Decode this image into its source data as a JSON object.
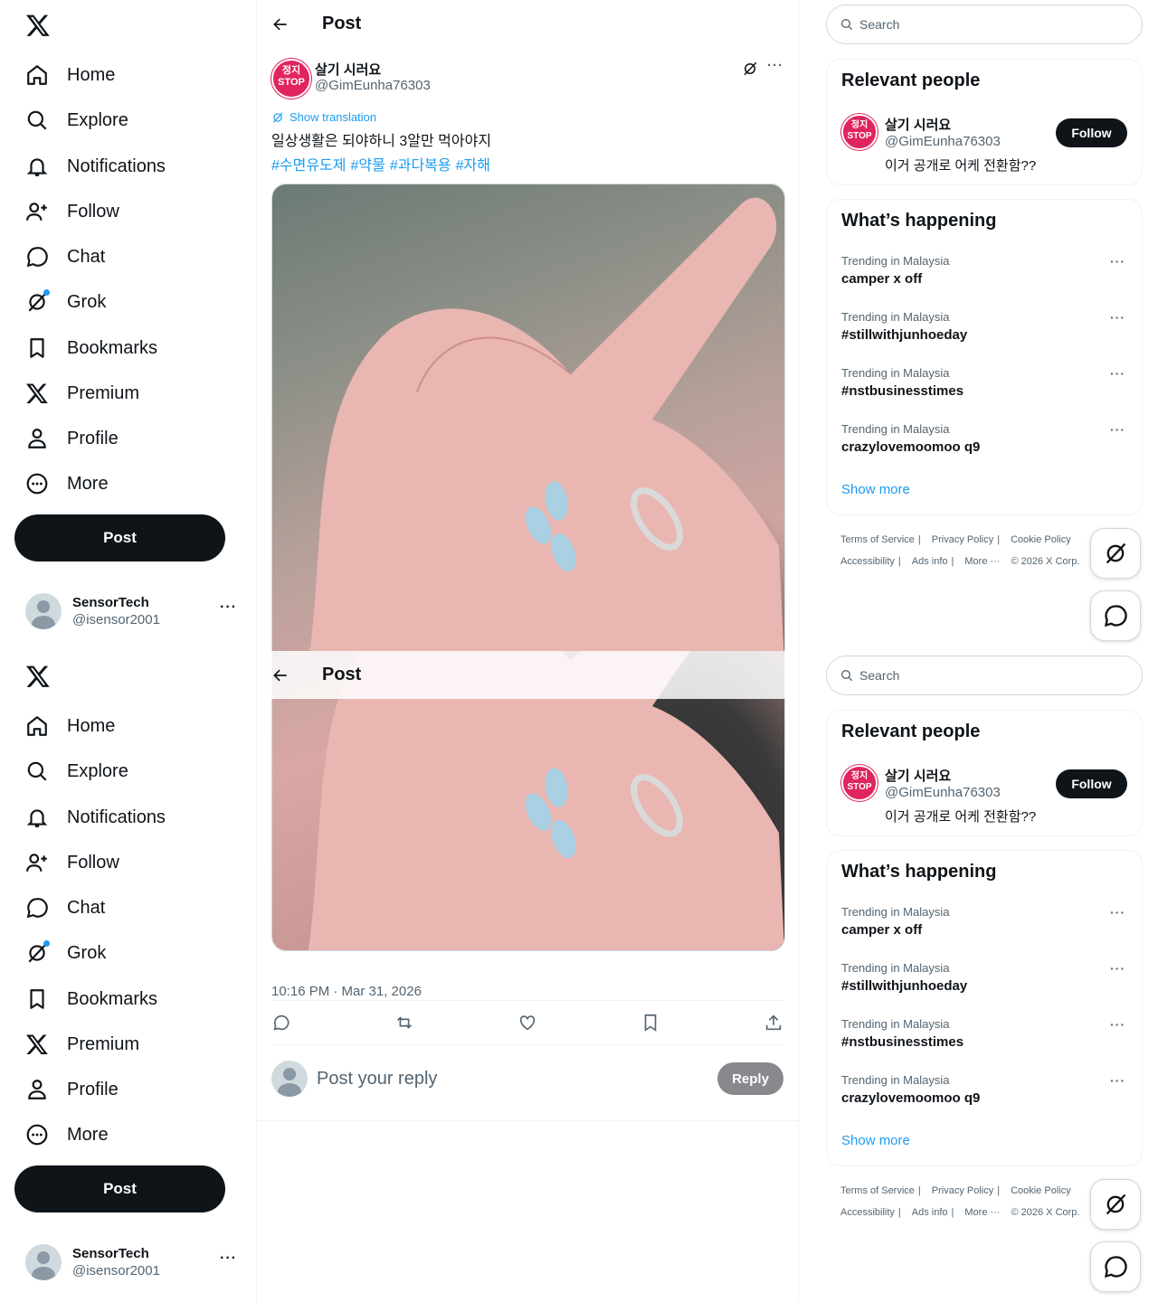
{
  "nav": {
    "items": [
      {
        "label": "Home",
        "icon": "home-icon"
      },
      {
        "label": "Explore",
        "icon": "search-icon"
      },
      {
        "label": "Notifications",
        "icon": "bell-icon"
      },
      {
        "label": "Follow",
        "icon": "add-person-icon"
      },
      {
        "label": "Chat",
        "icon": "chat-bubble-icon"
      },
      {
        "label": "Grok",
        "icon": "grok-icon"
      },
      {
        "label": "Bookmarks",
        "icon": "bookmark-icon"
      },
      {
        "label": "Premium",
        "icon": "x-logo-icon"
      },
      {
        "label": "Profile",
        "icon": "person-icon"
      },
      {
        "label": "More",
        "icon": "more-circle-icon"
      }
    ],
    "post_label": "Post",
    "account": {
      "name": "SensorTech",
      "handle": "@isensor2001",
      "more": "···"
    }
  },
  "header": {
    "title": "Post"
  },
  "post": {
    "avatar_text": [
      "정지",
      "STOP"
    ],
    "author_name": "살기 시러요",
    "author_handle": "@GimEunha76303",
    "more": "···",
    "translate_label": "Show translation",
    "text": "일상생활은 되야하니 3알만 먹아야지",
    "hashtags": [
      "#수면유도제",
      "#약물",
      "#과다복용",
      "#자해"
    ],
    "timestamp": "10:16 PM · Mar 31, 2026",
    "reply_placeholder": "Post your reply",
    "reply_button": "Reply"
  },
  "search": {
    "placeholder": "Search"
  },
  "relevant": {
    "title": "Relevant people",
    "name": "살기 시러요",
    "handle": "@GimEunha76303",
    "bio": "이거 공개로 어케 전환함??",
    "follow_label": "Follow"
  },
  "happening": {
    "title": "What’s happening",
    "trends": [
      {
        "context": "Trending in Malaysia",
        "title": "camper x off"
      },
      {
        "context": "Trending in Malaysia",
        "title": "#stillwithjunhoeday"
      },
      {
        "context": "Trending in Malaysia",
        "title": "#nstbusinesstimes"
      },
      {
        "context": "Trending in Malaysia",
        "title": "crazylovemoomoo q9"
      }
    ],
    "more_icon": "···",
    "show_more": "Show more"
  },
  "footer": {
    "row1": [
      "Terms of Service",
      "Privacy Policy",
      "Cookie Policy"
    ],
    "row2": [
      "Accessibility",
      "Ads info",
      "More ···",
      "© 2026 X Corp."
    ]
  },
  "colors": {
    "accent": "#1d9bf0",
    "text": "#0f1419",
    "muted": "#536471",
    "danger": "#e0245e"
  }
}
